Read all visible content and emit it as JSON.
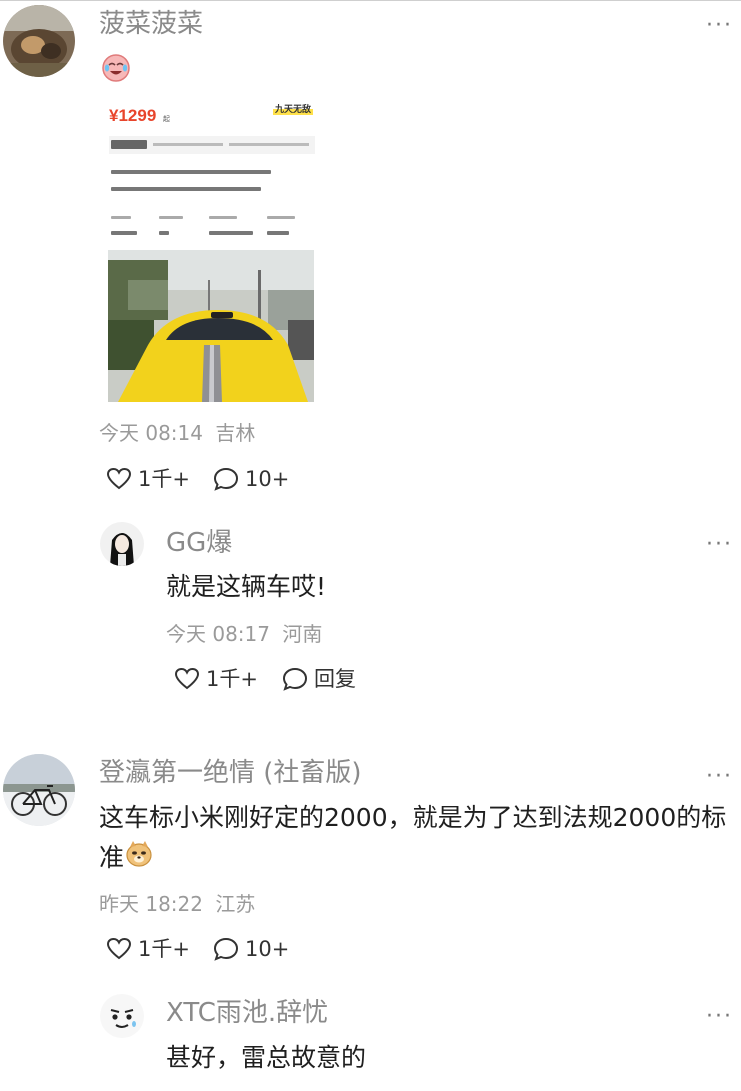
{
  "comments": [
    {
      "author": "菠菜菠菜",
      "emoji": "crying-laughing-emoji",
      "image": {
        "price": "¥1299",
        "price_unit": "起",
        "tag": "九天无敌"
      },
      "time": "今天 08:14",
      "location": "吉林",
      "likes": "1千+",
      "comments_count": "10+",
      "reply": {
        "author": "GG爆",
        "text": "就是这辆车哎!",
        "time": "今天 08:17",
        "location": "河南",
        "likes": "1千+",
        "reply_label": "回复"
      }
    },
    {
      "author": "登瀛第一绝情 (社畜版)",
      "text": "这车标小米刚好定的2000，就是为了达到法规2000的标准",
      "emoji": "doge-emoji",
      "time": "昨天 18:22",
      "location": "江苏",
      "likes": "1千+",
      "comments_count": "10+",
      "reply": {
        "author": "XTC雨池.辞忧",
        "text": "甚好，雷总故意的"
      }
    }
  ],
  "icons": {
    "like": "heart-outline-icon",
    "comment": "speech-bubble-icon",
    "more": "more-dots-icon"
  },
  "colors": {
    "name": "#8a8a8a",
    "meta": "#9a9a9a",
    "price": "#e8452c",
    "car": "#f2d21c"
  }
}
